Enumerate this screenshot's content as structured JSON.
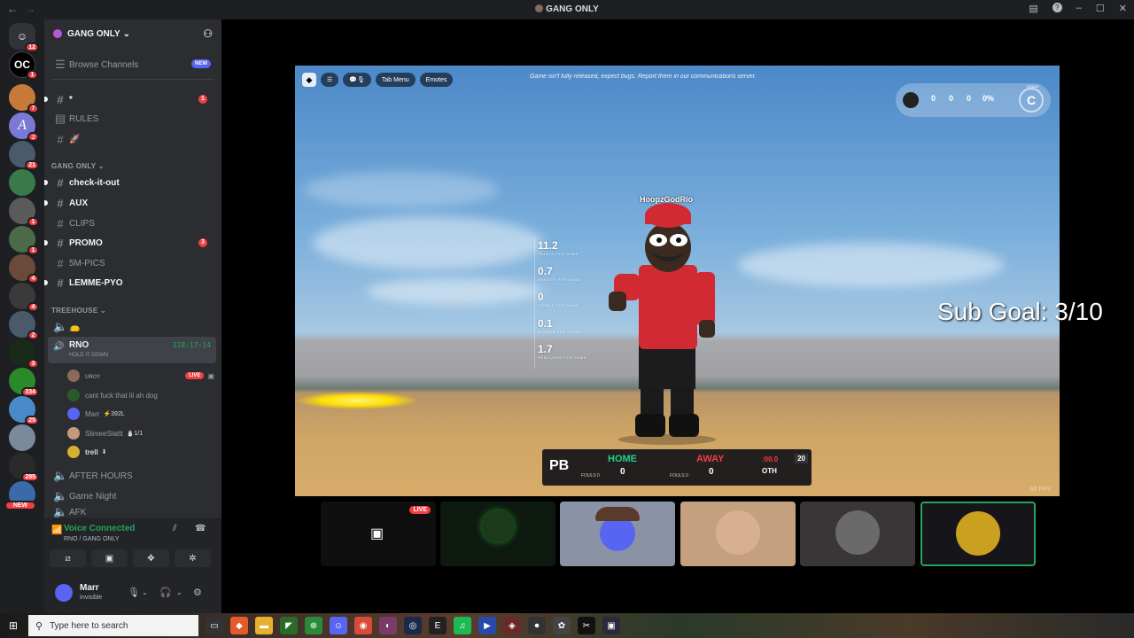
{
  "window": {
    "title": "GANG ONLY",
    "nav_back": "←",
    "nav_fwd": "→"
  },
  "guild_badges": [
    "12",
    "1",
    "7",
    "2",
    "21",
    "1",
    "1",
    "4",
    "4",
    "2",
    "3",
    "334",
    "25",
    "285"
  ],
  "guild_new": "NEW",
  "server": {
    "name": "GANG ONLY"
  },
  "channels": {
    "browse": "Browse Channels",
    "browse_badge": "NEW",
    "star": "*",
    "star_badge": "1",
    "rules": "RULES",
    "rocket": "🚀",
    "category_gang": "GANG ONLY",
    "check_it_out": "check-it-out",
    "aux": "AUX",
    "clips": "CLIPS",
    "promo": "PROMO",
    "promo_badge": "3",
    "five_m_pics": "5M-PICS",
    "lemme_pyo": "LEMME-PYO",
    "category_treehouse": "TREEHOUSE",
    "treehouse_first": "👝",
    "rno": "RNO",
    "rno_sub": "HOLD IT DOWN",
    "rno_time": "318:17:14",
    "after_hours": "AFTER HOURS",
    "game_night": "Game Night",
    "afk": "AFK"
  },
  "voice_users": [
    {
      "name": "ᴜʀᴏʏ",
      "live": "LIVE",
      "extra": ""
    },
    {
      "name": "cant fuck that lil ah dog",
      "live": "",
      "extra": ""
    },
    {
      "name": "Marr",
      "live": "",
      "extra": "⚡392L"
    },
    {
      "name": "SlimeeSlattt",
      "live": "",
      "extra": "⛄1/1"
    },
    {
      "name": "trell",
      "live": "",
      "extra": "⬇"
    }
  ],
  "voice_panel": {
    "status": "Voice Connected",
    "path": "RNO / GANG ONLY"
  },
  "user": {
    "name": "Marr",
    "status": "Invisible"
  },
  "game": {
    "tab_menu": "Tab Menu",
    "emotes": "Emotes",
    "notice": "Game isn't fully released, expect bugs. Report them in our communications server.",
    "stat_values": [
      "0",
      "0",
      "0",
      "0%"
    ],
    "grade_label": "GRADE",
    "grade": "C",
    "player_name": "HoopzGodRio",
    "stats": [
      {
        "value": "11.2",
        "label": "POINTS PER GAME"
      },
      {
        "value": "0.7",
        "label": "ASSISTS PER GAME"
      },
      {
        "value": "0",
        "label": "STEALS PER GAME"
      },
      {
        "value": "0.1",
        "label": "BLOCKS PER GAME"
      },
      {
        "value": "1.7",
        "label": "REBOUNDS PER GAME"
      }
    ],
    "fps": "60 FPS"
  },
  "scoreboard": {
    "logo": "PB",
    "home": "HOME",
    "away": "AWAY",
    "home_score": "0",
    "away_score": "0",
    "home_fouls": "FOULS 0",
    "away_fouls": "FOULS 0",
    "clock": ":00.0",
    "quarter": "OTH",
    "shot_clock": "20"
  },
  "overlay": {
    "sub_goal": "Sub Goal: 3/10"
  },
  "tiles": [
    {
      "live": "LIVE"
    },
    {
      "live": ""
    },
    {
      "live": ""
    },
    {
      "live": ""
    },
    {
      "live": ""
    },
    {
      "live": ""
    }
  ],
  "taskbar": {
    "search_placeholder": "Type here to search"
  },
  "colors": {
    "green": "#23a55a",
    "red": "#f23f43",
    "blurple": "#5865f2"
  }
}
